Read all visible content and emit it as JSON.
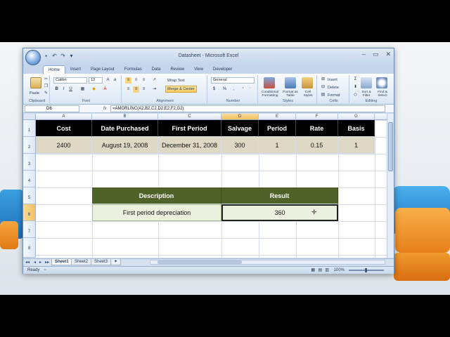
{
  "window": {
    "title": "Datasheet - Microsoft Excel"
  },
  "ribbon": {
    "tabs": [
      "Home",
      "Insert",
      "Page Layout",
      "Formulas",
      "Data",
      "Review",
      "View",
      "Developer"
    ],
    "active_tab": "Home",
    "clipboard": {
      "paste": "Paste",
      "label": "Clipboard"
    },
    "font": {
      "name": "Calibri",
      "size": "13",
      "label": "Font",
      "bold": "B",
      "italic": "I",
      "underline": "U"
    },
    "alignment": {
      "wrap_text": "Wrap Text",
      "merge_center": "Merge & Center",
      "label": "Alignment"
    },
    "number": {
      "format": "General",
      "currency": "$",
      "percent": "%",
      "comma": ",",
      "label": "Number"
    },
    "styles": {
      "conditional": "Conditional Formatting",
      "format_table": "Format as Table",
      "cell_styles": "Cell Styles",
      "label": "Styles"
    },
    "cells": {
      "insert": "Insert",
      "delete": "Delete",
      "format": "Format",
      "label": "Cells"
    },
    "editing": {
      "sum": "Σ",
      "sort_filter": "Sort & Filter",
      "find_select": "Find & Select",
      "label": "Editing"
    }
  },
  "formula_bar": {
    "name_box": "D6",
    "fx": "fx",
    "formula": "=AMORLINC(A2,B2,C2,D2,E2,F2,G2)"
  },
  "columns": [
    "A",
    "B",
    "C",
    "D",
    "E",
    "F",
    "G"
  ],
  "rows": [
    "1",
    "2",
    "3",
    "4",
    "5",
    "6",
    "7",
    "8"
  ],
  "table": {
    "headers": [
      "Cost",
      "Date Purchased",
      "First Period",
      "Salvage",
      "Period",
      "Rate",
      "Basis"
    ],
    "values": [
      "2400",
      "August 19, 2008",
      "December 31, 2008",
      "300",
      "1",
      "0.15",
      "1"
    ]
  },
  "result_table": {
    "desc_header": "Description",
    "result_header": "Result",
    "desc_value": "First period depreciation",
    "result_value": "360"
  },
  "sheet_tabs": [
    "Sheet1",
    "Sheet2",
    "Sheet3"
  ],
  "status": {
    "ready": "Ready",
    "zoom": "100%"
  },
  "colors": {
    "header_bg": "#000000",
    "value_bg": "#DDD9C4",
    "desc_header_bg": "#4F6228",
    "desc_value_bg": "#EBF1DE"
  }
}
